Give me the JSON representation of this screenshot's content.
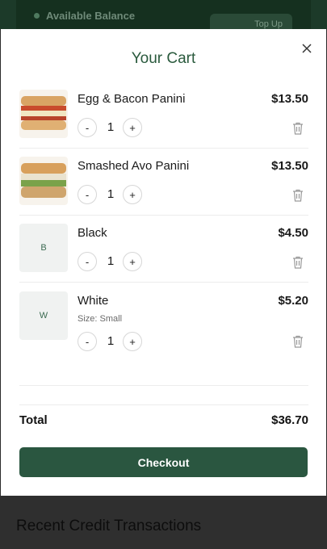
{
  "background": {
    "balance_label": "Available Balance",
    "topup_label": "Top Up",
    "recent_title": "Recent Credit Transactions"
  },
  "cart": {
    "title": "Your Cart",
    "items": [
      {
        "name": "Egg & Bacon Panini",
        "price": "$13.50",
        "qty": "1",
        "sub": "",
        "placeholder": ""
      },
      {
        "name": "Smashed Avo Panini",
        "price": "$13.50",
        "qty": "1",
        "sub": "",
        "placeholder": ""
      },
      {
        "name": "Black",
        "price": "$4.50",
        "qty": "1",
        "sub": "",
        "placeholder": "B"
      },
      {
        "name": "White",
        "price": "$5.20",
        "qty": "1",
        "sub": "Size: Small",
        "placeholder": "W"
      }
    ],
    "qty_minus_label": "-",
    "qty_plus_label": "+",
    "total_label": "Total",
    "total_value": "$36.70",
    "checkout_label": "Checkout"
  },
  "colors": {
    "accent": "#2a5640",
    "title": "#2a5a3d"
  }
}
